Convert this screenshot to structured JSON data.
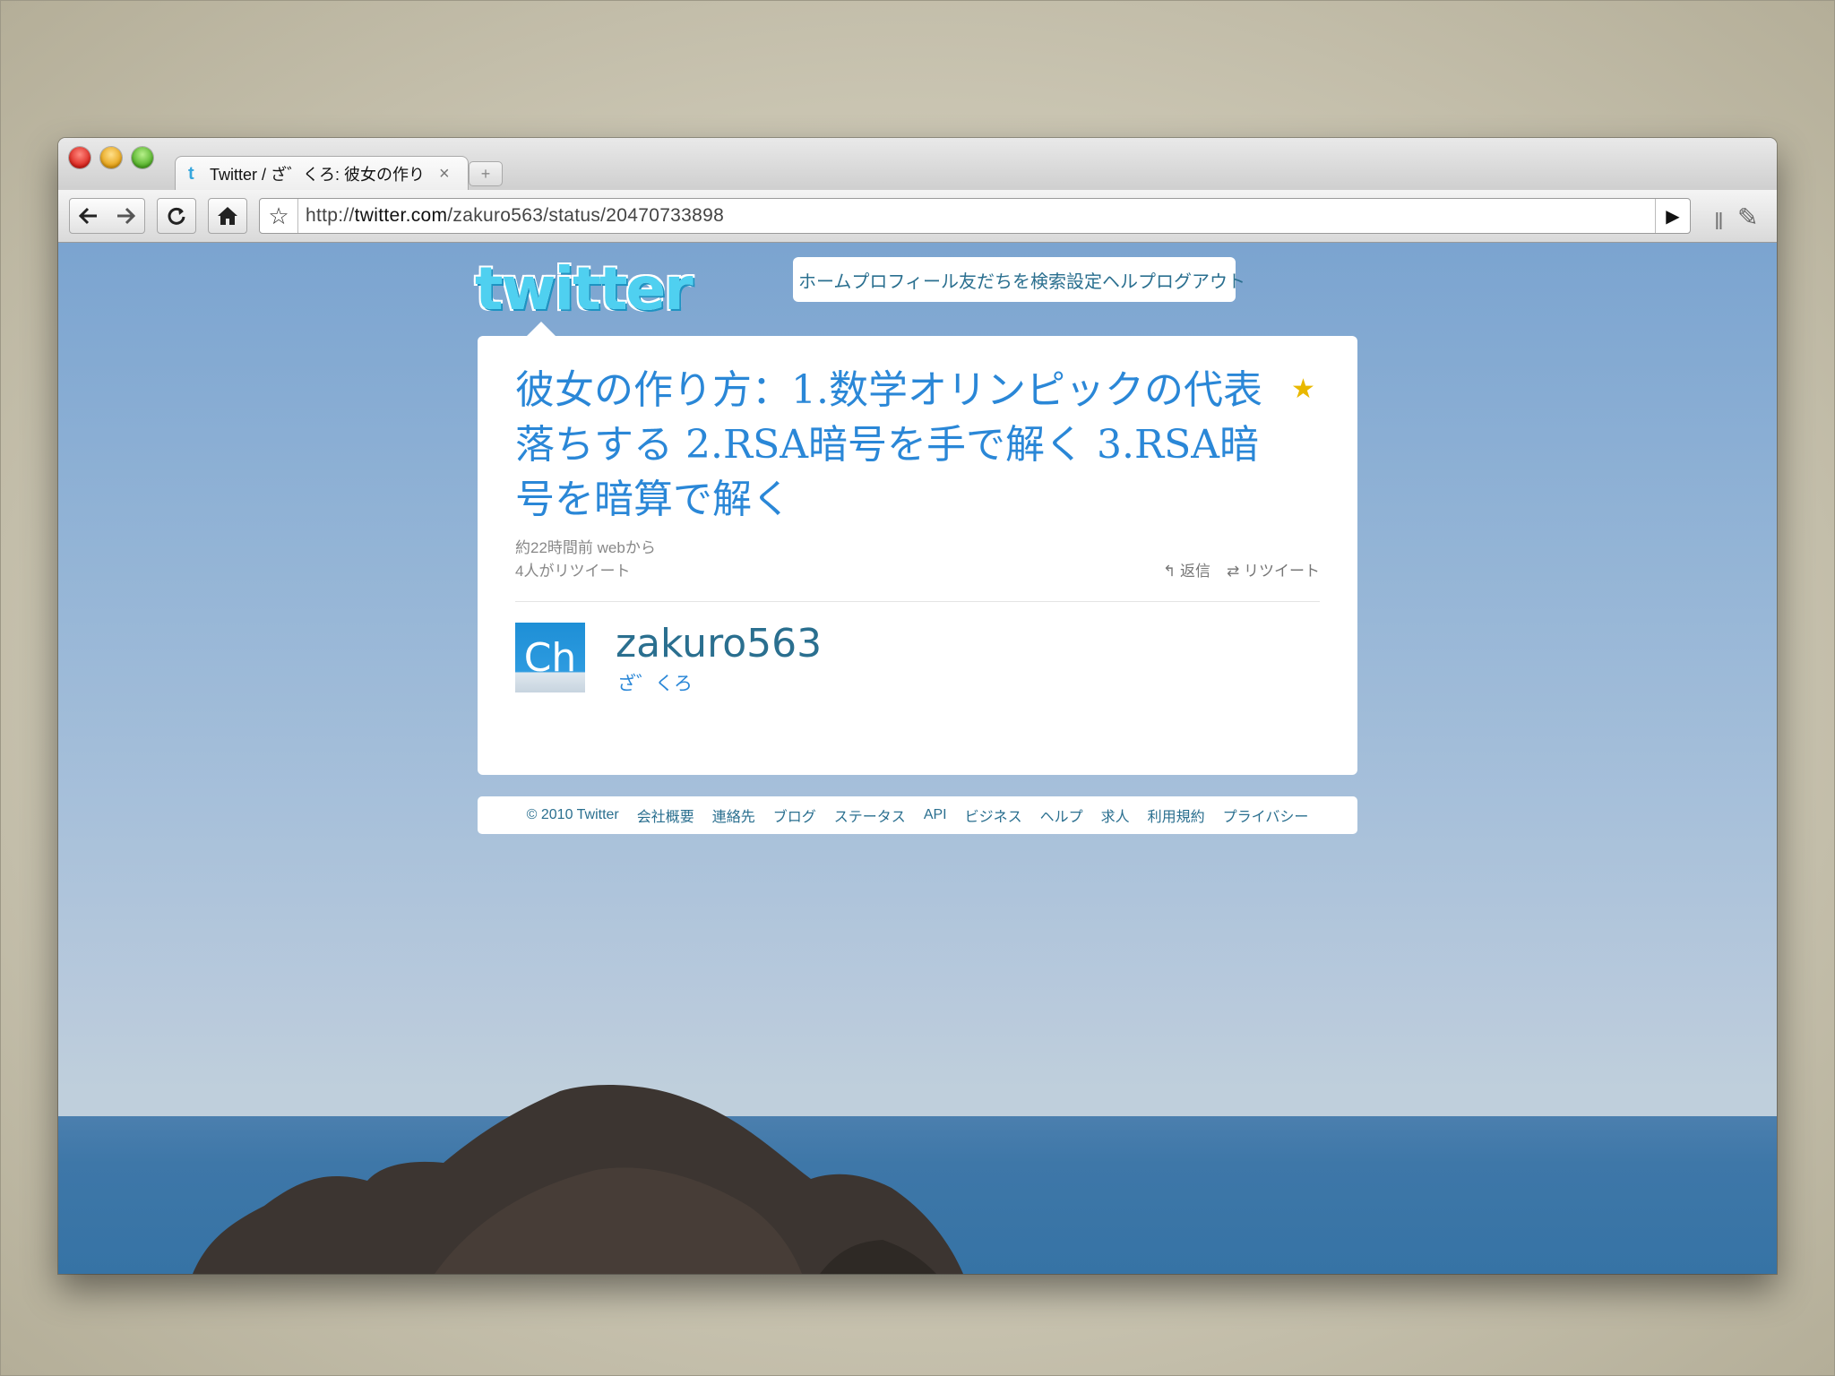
{
  "browser": {
    "tab_title": "Twitter / ざ゛くろ: 彼女の作り",
    "tab_favicon": "t",
    "tab_close": "×",
    "new_tab": "+",
    "url_prefix": "http://",
    "url_host": "twitter.com",
    "url_path": "/zakuro563/status/20470733898",
    "icons": {
      "back": "back-arrow-icon",
      "forward": "forward-arrow-icon",
      "reload": "reload-icon",
      "home": "home-icon",
      "bookmark": "star-icon",
      "go": "play-icon",
      "wrench": "wrench-icon"
    }
  },
  "site": {
    "logo": "twitter",
    "nav": [
      "ホーム",
      "プロフィール",
      "友だちを検索",
      "設定",
      "ヘルプ",
      "ログアウト"
    ]
  },
  "tweet": {
    "text": "彼女の作り方：1.数学オリンピックの代表落ちする 2.RSA暗号を手で解く 3.RSA暗号を暗算で解く",
    "timestamp": "約22時間前 webから",
    "retweet_count": "4人がリツイート",
    "reply_label": "返信",
    "retweet_label": "リツイート",
    "accent_color": "#2a87d7"
  },
  "user": {
    "avatar_text": "Ch",
    "screen_name": "zakuro563",
    "name": "ざ゛くろ"
  },
  "footer": {
    "links": [
      "© 2010 Twitter",
      "会社概要",
      "連絡先",
      "ブログ",
      "ステータス",
      "API",
      "ビジネス",
      "ヘルプ",
      "求人",
      "利用規約",
      "プライバシー"
    ]
  }
}
